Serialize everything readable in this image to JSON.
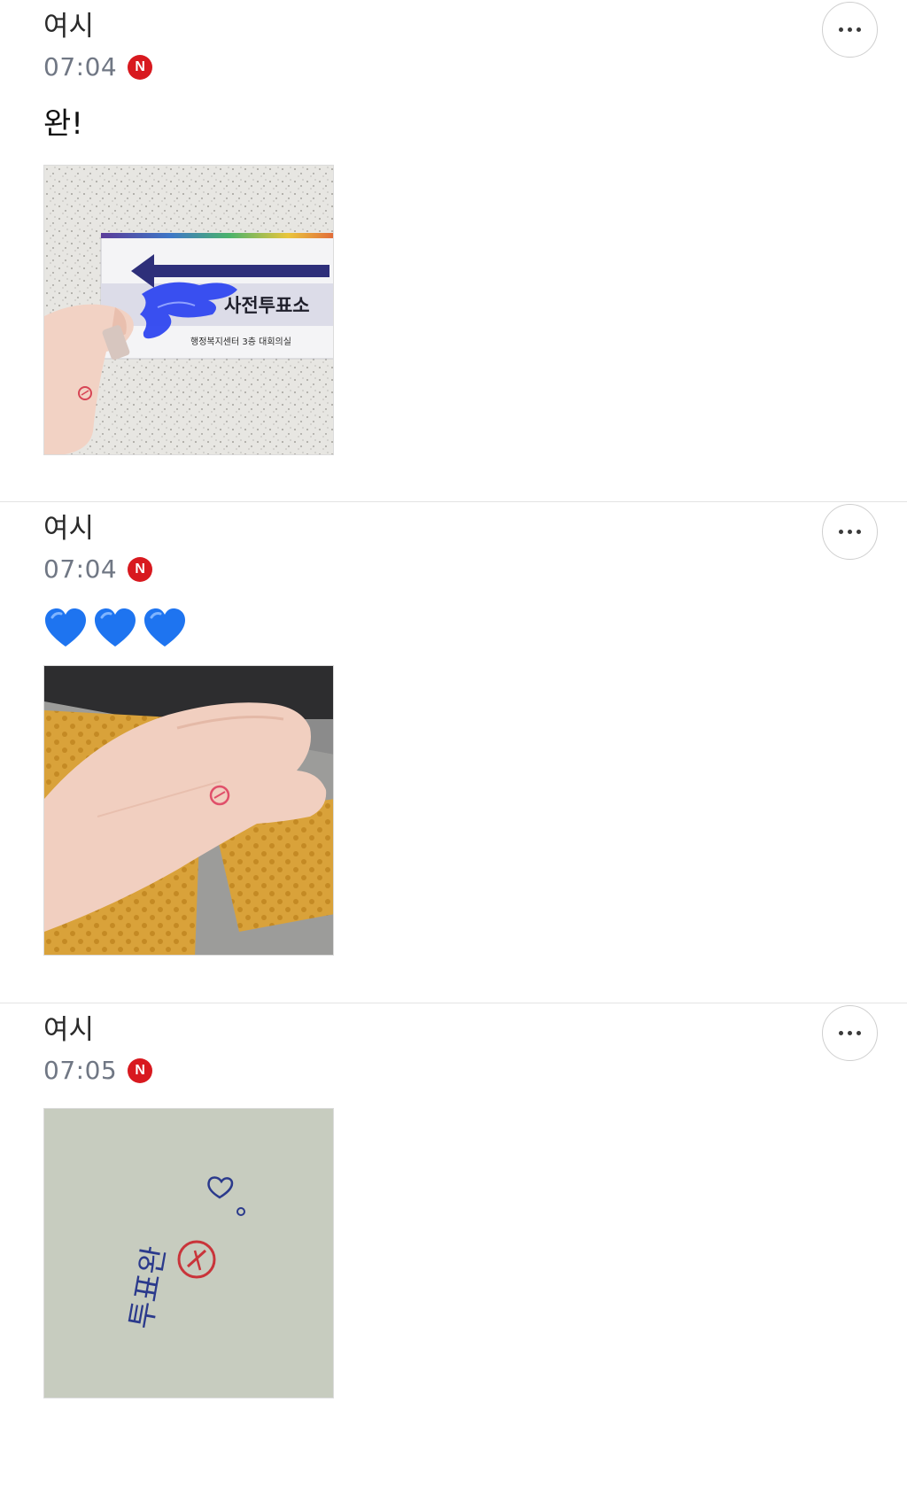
{
  "posts": [
    {
      "author": "여시",
      "time": "07:04",
      "badge": "N",
      "text": "완!",
      "photo": {
        "description_icon": "photo-voting-sign",
        "sign_title": "사전투표소",
        "sign_subtitle": "행정복지센터 3층 대회의실"
      }
    },
    {
      "author": "여시",
      "time": "07:04",
      "badge": "N",
      "emoji": [
        "💙",
        "💙",
        "💙"
      ],
      "photo": {
        "description_icon": "photo-hand-stamp"
      }
    },
    {
      "author": "여시",
      "time": "07:05",
      "badge": "N",
      "photo": {
        "description_icon": "photo-handwritten-note",
        "note_text": "투표완"
      }
    }
  ],
  "colors": {
    "badge_red": "#d8191f",
    "time_gray": "#707784",
    "heart_blue": "#1e74f0",
    "divider": "#e3e3e3"
  }
}
